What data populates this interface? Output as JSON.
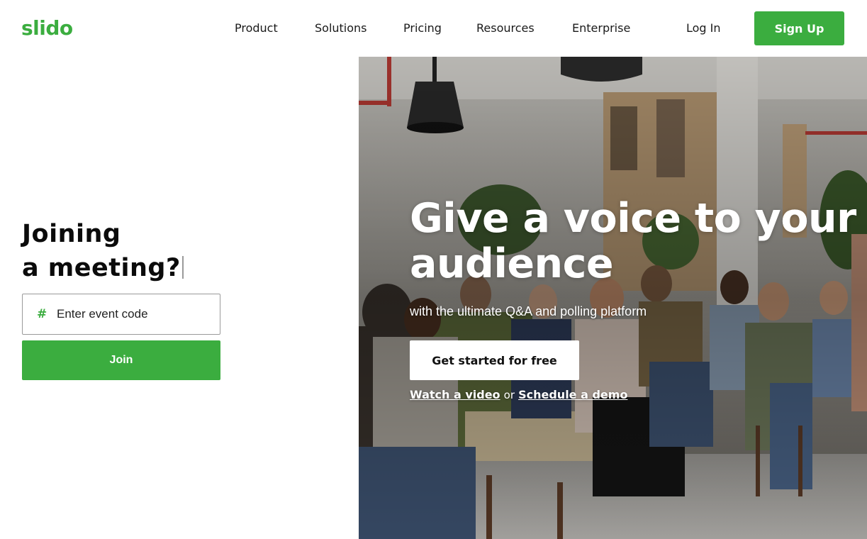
{
  "header": {
    "logo": "slido",
    "nav": [
      "Product",
      "Solutions",
      "Pricing",
      "Resources",
      "Enterprise"
    ],
    "login": "Log In",
    "signup": "Sign Up"
  },
  "join": {
    "title_line1": "Joining",
    "title_line2": "a meeting?",
    "hash_symbol": "#",
    "input_placeholder": "Enter event code",
    "button": "Join"
  },
  "hero": {
    "headline": "Give a voice to your audience",
    "subheadline": "with the ultimate Q&A and polling platform",
    "cta": "Get started for free",
    "link_video": "Watch a video",
    "link_or": "or",
    "link_demo": "Schedule a demo"
  },
  "colors": {
    "brand_green": "#3bad3f",
    "text_dark": "#0b0b0b"
  }
}
